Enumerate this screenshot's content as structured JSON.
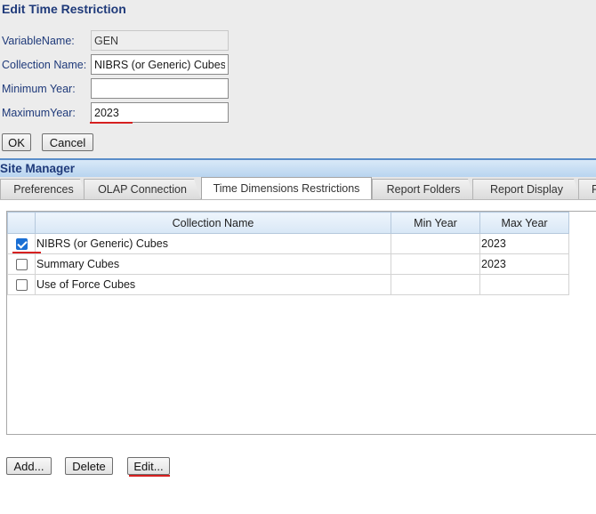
{
  "dialog": {
    "title": "Edit Time Restriction",
    "fields": {
      "variable_name": {
        "label": "VariableName:",
        "value": "GEN"
      },
      "collection_name": {
        "label": "Collection Name:",
        "value": "NIBRS (or Generic) Cubes"
      },
      "minimum_year": {
        "label": "Minimum Year:",
        "value": ""
      },
      "maximum_year": {
        "label": "MaximumYear:",
        "value": "2023"
      }
    },
    "ok_label": "OK",
    "cancel_label": "Cancel"
  },
  "site_manager": {
    "title": "Site Manager",
    "tabs": [
      {
        "label": "Preferences",
        "active": false
      },
      {
        "label": "OLAP Connection",
        "active": false
      },
      {
        "label": "Time Dimensions Restrictions",
        "active": true
      },
      {
        "label": "Report Folders",
        "active": false
      },
      {
        "label": "Report Display",
        "active": false
      },
      {
        "label": "R",
        "active": false
      }
    ],
    "table": {
      "columns": [
        "",
        "Collection Name",
        "Min Year",
        "Max Year"
      ],
      "rows": [
        {
          "checked": true,
          "name": "NIBRS (or Generic) Cubes",
          "min_year": "",
          "max_year": "2023"
        },
        {
          "checked": false,
          "name": "Summary Cubes",
          "min_year": "",
          "max_year": "2023"
        },
        {
          "checked": false,
          "name": "Use of Force Cubes",
          "min_year": "",
          "max_year": ""
        }
      ]
    },
    "buttons": {
      "add": "Add...",
      "delete": "Delete",
      "edit": "Edit..."
    }
  },
  "colors": {
    "title_blue": "#1f3a7a",
    "annotation_red": "#d62020",
    "checkbox_blue": "#1a6fd4"
  }
}
